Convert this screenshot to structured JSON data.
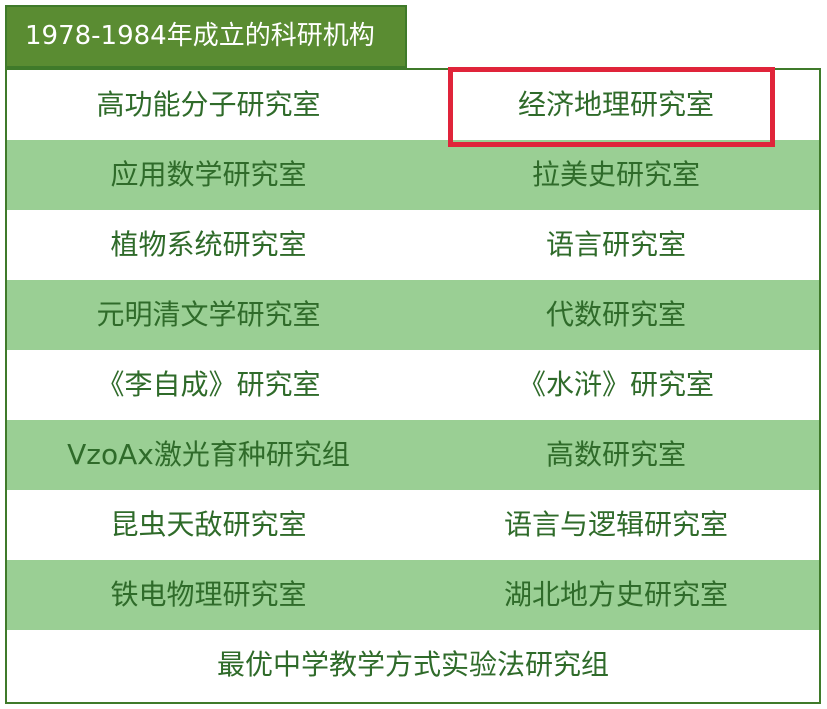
{
  "title": "1978-1984年成立的科研机构",
  "colors": {
    "title_bg": "#5a8c32",
    "border": "#3f7a2a",
    "row_green": "#9acf94",
    "text": "#2f6b2a",
    "highlight": "#e0243a"
  },
  "rows": [
    {
      "left": "高功能分子研究室",
      "right": "经济地理研究室"
    },
    {
      "left": "应用数学研究室",
      "right": "拉美史研究室"
    },
    {
      "left": "植物系统研究室",
      "right": "语言研究室"
    },
    {
      "left": "元明清文学研究室",
      "right": "代数研究室"
    },
    {
      "left": "《李自成》研究室",
      "right": "《水浒》研究室"
    },
    {
      "left": "VzoAx激光育种研究组",
      "right": "高数研究室"
    },
    {
      "left": "昆虫天敌研究室",
      "right": "语言与逻辑研究室"
    },
    {
      "left": "铁电物理研究室",
      "right": "湖北地方史研究室"
    }
  ],
  "last_row": "最优中学教学方式实验法研究组",
  "highlighted_item": "经济地理研究室"
}
